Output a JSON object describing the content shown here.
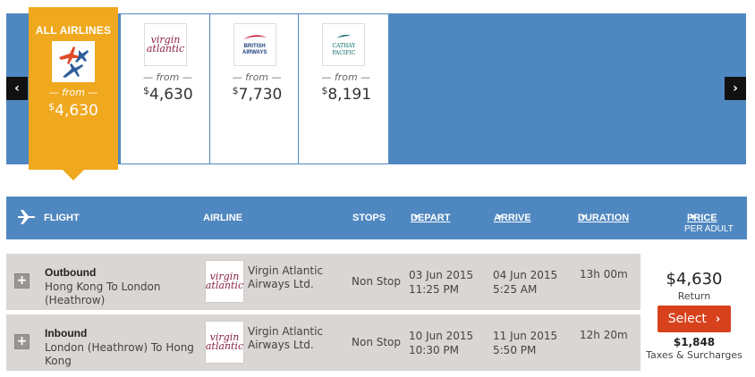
{
  "carousel": {
    "all_airlines": {
      "title": "ALL AIRLINES",
      "from": "— from —",
      "currency": "$",
      "amount": "4,630"
    },
    "airlines": [
      {
        "name": "Virgin Atlantic",
        "logo_text": [
          "virgin",
          "atlantic"
        ],
        "from": "— from —",
        "currency": "$",
        "amount": "4,630"
      },
      {
        "name": "British Airways",
        "logo_text": [
          "BRITISH",
          "AIRWAYS"
        ],
        "from": "— from —",
        "currency": "$",
        "amount": "7,730"
      },
      {
        "name": "Cathay Pacific",
        "logo_text": [
          "CATHAY PACIFIC",
          ""
        ],
        "from": "— from —",
        "currency": "$",
        "amount": "8,191"
      }
    ]
  },
  "table": {
    "headers": {
      "flight": "FLIGHT",
      "airline": "AIRLINE",
      "stops": "STOPS",
      "depart": "DEPART",
      "arrive": "ARRIVE",
      "duration": "DURATION",
      "price": "PRICE",
      "per_adult": "PER ADULT"
    },
    "rows": [
      {
        "direction": "Outbound",
        "route": "Hong Kong To London (Heathrow)",
        "airline": "Virgin Atlantic Airways Ltd.",
        "stops": "Non Stop",
        "depart_date": "03 Jun 2015",
        "depart_time": "11:25 PM",
        "arrive_date": "04 Jun 2015",
        "arrive_time": "5:25 AM",
        "duration": "13h 00m"
      },
      {
        "direction": "Inbound",
        "route": "London (Heathrow) To Hong Kong",
        "airline": "Virgin Atlantic Airways Ltd.",
        "stops": "Non Stop",
        "depart_date": "10 Jun 2015",
        "depart_time": "10:30 PM",
        "arrive_date": "11 Jun 2015",
        "arrive_time": "5:50 PM",
        "duration": "12h 20m"
      }
    ],
    "price": {
      "total": "$4,630",
      "type": "Return",
      "select_label": "Select",
      "taxes_amount": "$1,848",
      "taxes_label": "Taxes & Surcharges"
    }
  },
  "colors": {
    "primary_blue": "#4f87c0",
    "accent_orange": "#f0a81e",
    "select_red": "#d7421c"
  }
}
